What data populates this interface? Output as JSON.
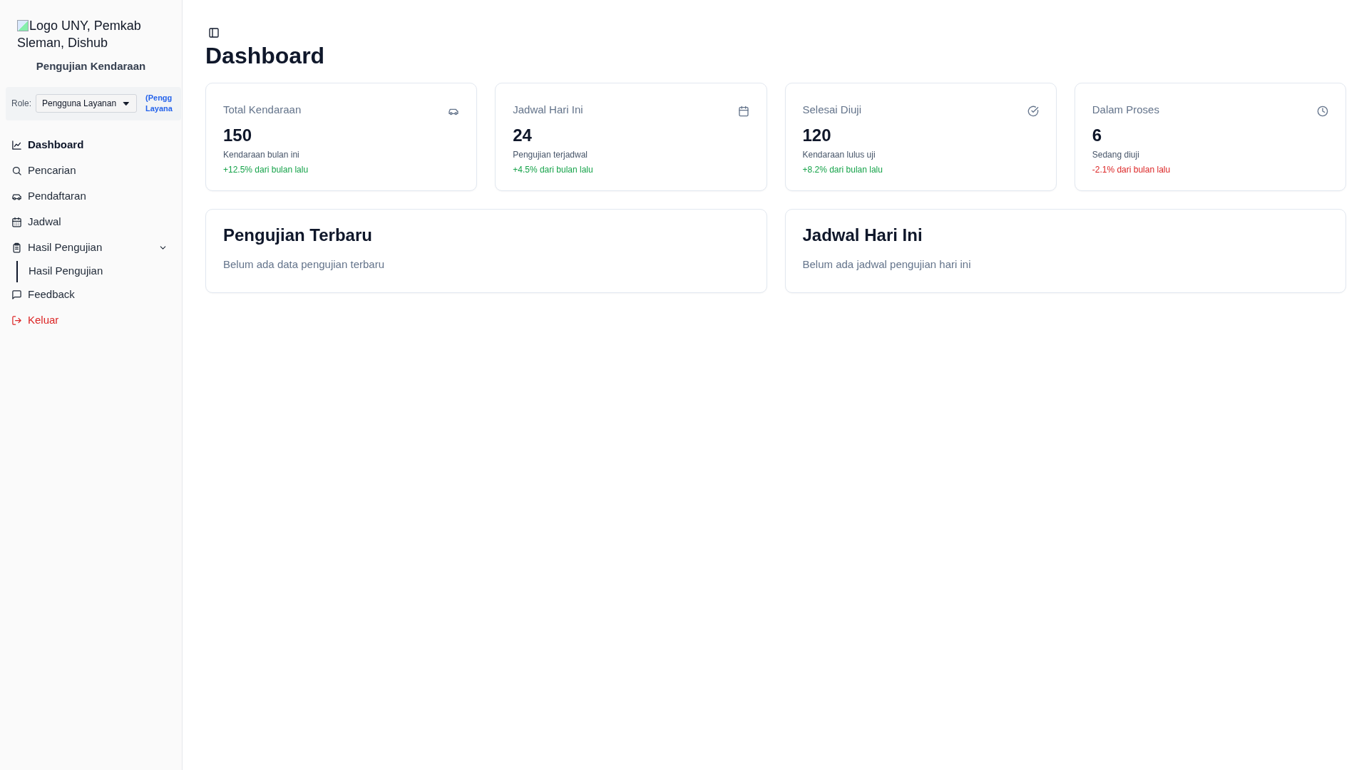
{
  "sidebar": {
    "logo_alt": "Logo UNY, Pemkab Sleman, Dishub",
    "app_name": "Pengujian Kendaraan",
    "role": {
      "label": "Role:",
      "value": "Pengguna Layanan",
      "note_lines": [
        "(Pengg",
        "Layana"
      ]
    },
    "items": [
      {
        "label": "Dashboard",
        "selected": true,
        "kind": "link"
      },
      {
        "label": "Pencarian",
        "selected": false,
        "kind": "link"
      },
      {
        "label": "Pendaftaran",
        "selected": false,
        "kind": "link"
      },
      {
        "label": "Jadwal",
        "selected": false,
        "kind": "link"
      },
      {
        "label": "Hasil Pengujian",
        "selected": false,
        "kind": "group",
        "expanded": true,
        "children": [
          {
            "label": "Hasil Pengujian",
            "selected": false
          }
        ]
      },
      {
        "label": "Feedback",
        "selected": false,
        "kind": "link"
      },
      {
        "label": "Keluar",
        "selected": false,
        "kind": "danger"
      }
    ]
  },
  "page": {
    "title": "Dashboard"
  },
  "stats": [
    {
      "title": "Total Kendaraan",
      "value": "150",
      "caption": "Kendaraan bulan ini",
      "change": "+12.5% dari bulan lalu",
      "color": "#16a34a"
    },
    {
      "title": "Jadwal Hari Ini",
      "value": "24",
      "caption": "Pengujian terjadwal",
      "change": "+4.5% dari bulan lalu",
      "color": "#16a34a"
    },
    {
      "title": "Selesai Diuji",
      "value": "120",
      "caption": "Kendaraan lulus uji",
      "change": "+8.2% dari bulan lalu",
      "color": "#16a34a"
    },
    {
      "title": "Dalam Proses",
      "value": "6",
      "caption": "Sedang diuji",
      "change": "-2.1% dari bulan lalu",
      "color": "#dc2626"
    }
  ],
  "panels": [
    {
      "title": "Pengujian Terbaru",
      "empty_text": "Belum ada data pengujian terbaru"
    },
    {
      "title": "Jadwal Hari Ini",
      "empty_text": "Belum ada jadwal pengujian hari ini"
    }
  ]
}
